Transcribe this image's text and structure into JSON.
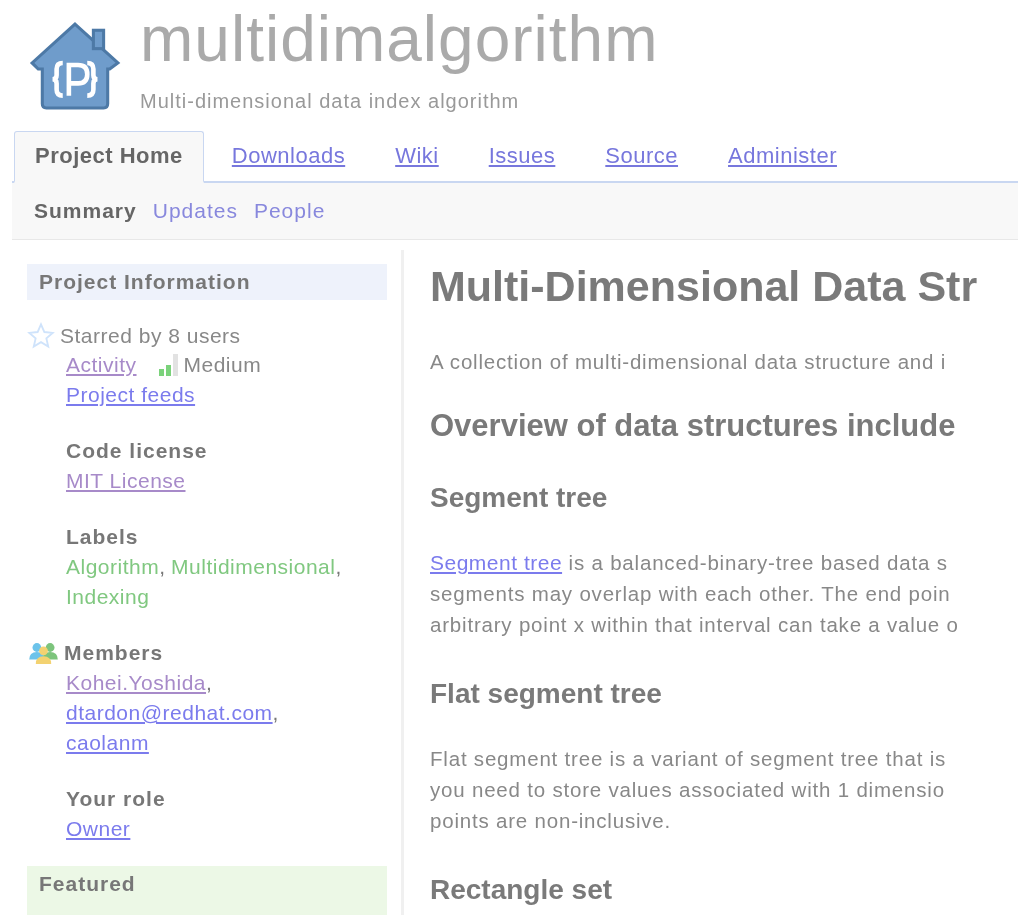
{
  "header": {
    "title": "multidimalgorithm",
    "subtitle": "Multi-dimensional data index algorithm"
  },
  "tabs": [
    {
      "label": "Project Home",
      "selected": true
    },
    {
      "label": "Downloads",
      "selected": false
    },
    {
      "label": "Wiki",
      "selected": false
    },
    {
      "label": "Issues",
      "selected": false
    },
    {
      "label": "Source",
      "selected": false
    },
    {
      "label": "Administer",
      "selected": false
    }
  ],
  "subtabs": [
    {
      "label": "Summary",
      "selected": true
    },
    {
      "label": "Updates",
      "selected": false
    },
    {
      "label": "People",
      "selected": false
    }
  ],
  "sidebar": {
    "title": "Project Information",
    "starred": "Starred by 8 users",
    "activity": {
      "label": "Activity",
      "visited": true,
      "level": 0.67,
      "reading": "Medium"
    },
    "feeds": {
      "label": "Project feeds",
      "visited": false
    },
    "license": {
      "heading": "Code license",
      "link": {
        "label": "MIT License",
        "visited": true
      }
    },
    "labels": {
      "heading": "Labels",
      "items": [
        {
          "label": "Algorithm",
          "separator": ","
        },
        {
          "label": "Multidimensional",
          "separator": ","
        },
        {
          "label": "Indexing"
        }
      ]
    },
    "members": {
      "heading": "Members",
      "items": [
        {
          "label": "Kohei.Yoshida",
          "visited": true,
          "separator": ","
        },
        {
          "label": "dtardon@redhat.com",
          "visited": false,
          "separator": ","
        },
        {
          "label": "caolanm",
          "visited": false
        }
      ]
    },
    "role": {
      "heading": "Your role",
      "link": {
        "label": "Owner",
        "visited": false
      }
    },
    "featured": "Featured"
  },
  "content": {
    "title": "Multi-Dimensional Data Str",
    "intro": "A collection of multi-dimensional data structure and i",
    "overview": "Overview of data structures include",
    "sections": [
      {
        "heading": "Segment tree",
        "link": "Segment tree",
        "lines": [
          " is a balanced-binary-tree based data s",
          "segments may overlap with each other. The end poin",
          "arbitrary point x within that interval can take a value o"
        ]
      },
      {
        "heading": "Flat segment tree",
        "lines": [
          "Flat segment tree is a variant of segment tree that is",
          "you need to store values associated with 1 dimensio",
          "points are non-inclusive."
        ]
      },
      {
        "heading": "Rectangle set"
      }
    ]
  }
}
